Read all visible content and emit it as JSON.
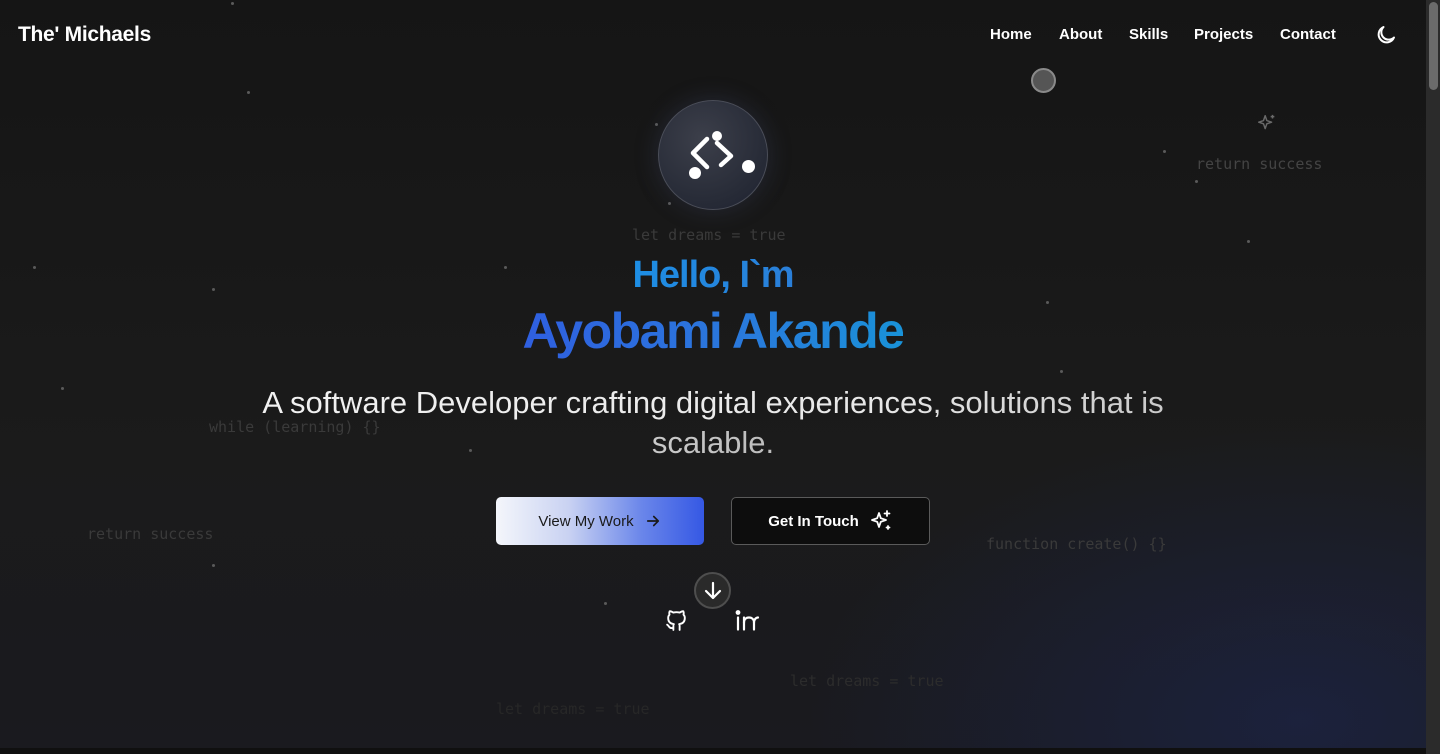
{
  "brand": "The' Michaels",
  "nav": {
    "items": [
      {
        "label": "Home"
      },
      {
        "label": "About"
      },
      {
        "label": "Skills"
      },
      {
        "label": "Projects"
      },
      {
        "label": "Contact"
      }
    ],
    "theme_toggle_icon": "moon-icon"
  },
  "hero": {
    "logo_icon": "code-branch-icon",
    "greeting": "Hello, I`m",
    "name": "Ayobami Akande",
    "tagline": "A software Developer crafting digital experiences, solutions that is scalable.",
    "primary_button": {
      "label": "View My Work",
      "icon": "arrow-right-icon"
    },
    "secondary_button": {
      "label": "Get In Touch",
      "icon": "sparkles-icon"
    },
    "scroll_icon": "arrow-down-circle-icon",
    "socials": [
      {
        "icon": "github-icon"
      },
      {
        "icon": "linkedin-icon"
      }
    ]
  },
  "background_code": [
    "return success",
    "let dreams = true",
    "while (learning) {}",
    "return success",
    "function create() {}",
    "let dreams = true",
    "let dreams = true"
  ],
  "colors": {
    "background": "#161616",
    "accent_blue": "#2f5fe0",
    "accent_sky": "#1b8fe0"
  }
}
